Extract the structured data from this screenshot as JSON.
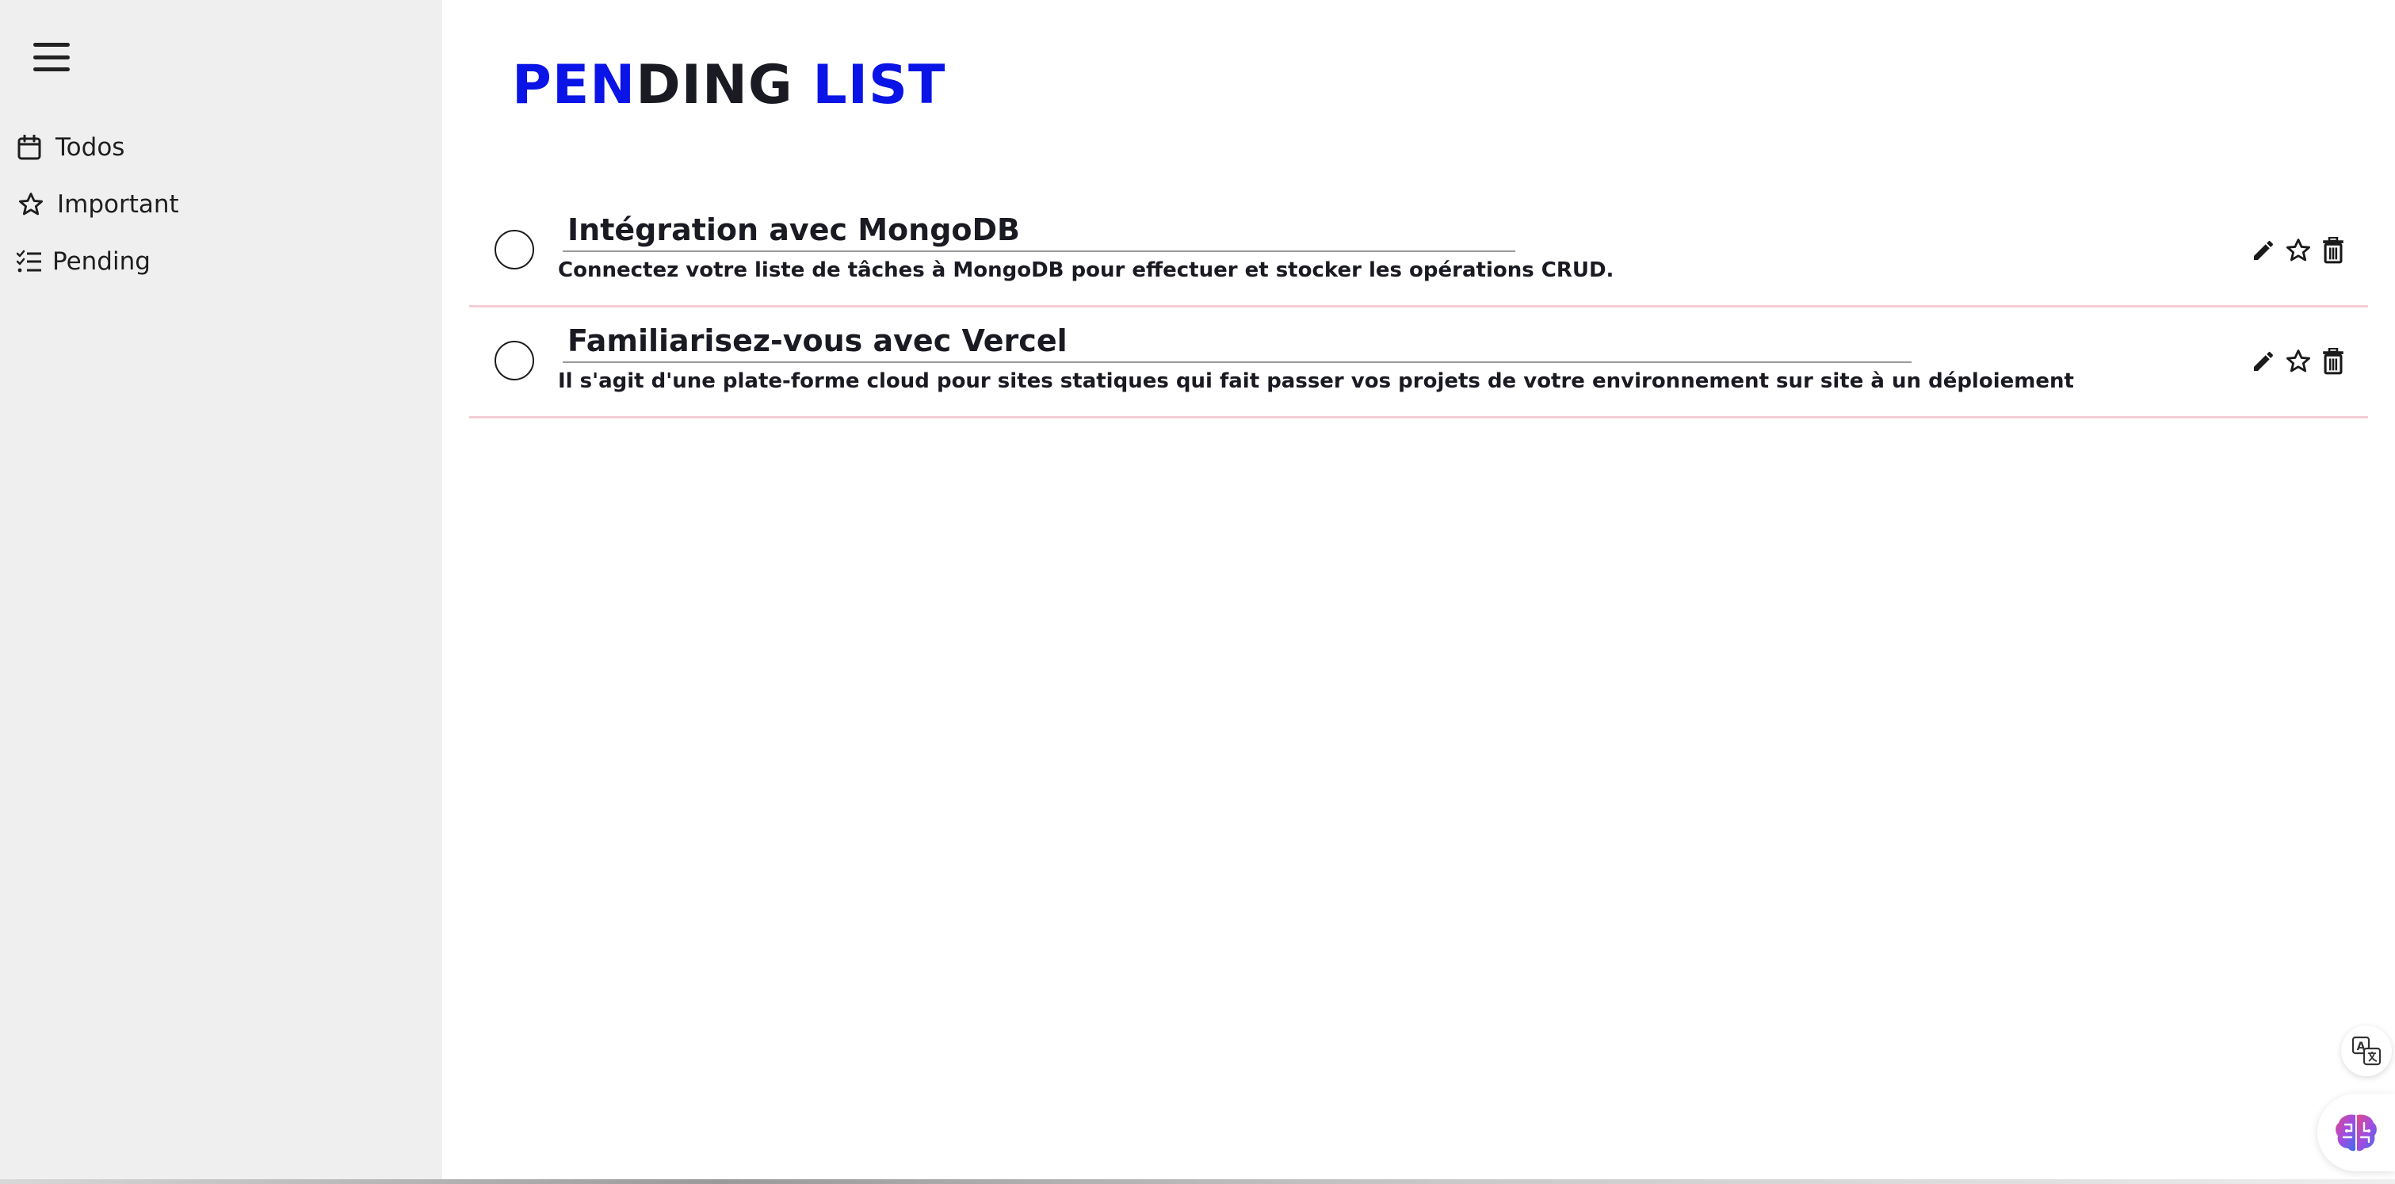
{
  "sidebar": {
    "menu_icon": "hamburger-menu-icon",
    "items": [
      {
        "label": "Todos",
        "icon": "calendar-icon"
      },
      {
        "label": "Important",
        "icon": "star-outline-icon"
      },
      {
        "label": "Pending",
        "icon": "checklist-icon"
      }
    ]
  },
  "main": {
    "title_parts": [
      "PEN",
      "DING",
      " LIST"
    ],
    "title_colors": {
      "accent": "#0a14e6",
      "dark": "#1a1a22"
    },
    "todos": [
      {
        "title": "Intégration avec MongoDB",
        "description": "Connectez votre liste de tâches à MongoDB pour effectuer et stocker les opérations CRUD.",
        "completed": false
      },
      {
        "title": "Familiarisez-vous avec Vercel",
        "description": "Il s'agit d'une plate-forme cloud pour sites statiques qui fait passer vos projets de votre environnement sur site à un déploiement",
        "completed": false
      }
    ],
    "row_actions": [
      "edit-pencil-icon",
      "star-outline-icon",
      "trash-icon"
    ],
    "divider_color": "#f3cdd6"
  },
  "widgets": {
    "translate_icon": "translate-icon",
    "ai_icon": "brain-icon"
  }
}
